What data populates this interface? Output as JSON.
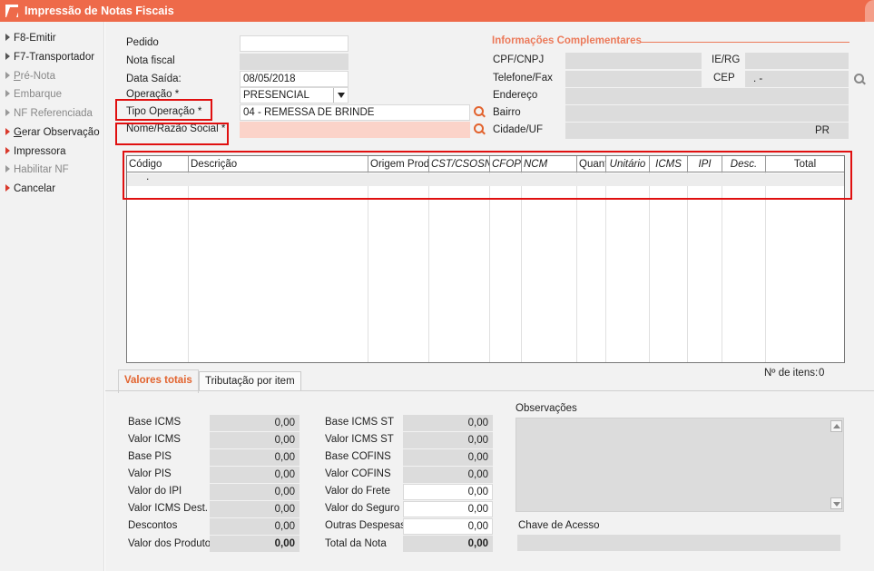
{
  "window": {
    "title": "Impressão de Notas Fiscais"
  },
  "sidebar": {
    "items": [
      {
        "label": "F8-Emitir",
        "state": "normal"
      },
      {
        "label": "F7-Transportador",
        "state": "normal"
      },
      {
        "label": "Pré-Nota",
        "state": "disabled"
      },
      {
        "label": "Embarque",
        "state": "disabled"
      },
      {
        "label": "NF Referenciada",
        "state": "disabled"
      },
      {
        "label": "Gerar Observação",
        "state": "red"
      },
      {
        "label": "Impressora",
        "state": "red"
      },
      {
        "label": "Habilitar NF",
        "state": "disabled"
      },
      {
        "label": "Cancelar",
        "state": "red"
      }
    ]
  },
  "form": {
    "pedido": {
      "label": "Pedido",
      "value": ""
    },
    "nota_fiscal": {
      "label": "Nota fiscal",
      "value": ""
    },
    "data_saida": {
      "label": "Data Saída:",
      "value": "08/05/2018"
    },
    "operacao": {
      "label": "Operação *",
      "value": "PRESENCIAL"
    },
    "tipo_operacao": {
      "label": "Tipo Operação *",
      "value": "04 - REMESSA DE BRINDE"
    },
    "nome_razao": {
      "label": "Nome/Razão Social *",
      "value": ""
    }
  },
  "info_complementares": {
    "title": "Informações Complementares",
    "cpf_cnpj": {
      "label": "CPF/CNPJ",
      "value": ""
    },
    "ie_rg": {
      "label": "IE/RG",
      "value": ""
    },
    "telefone": {
      "label": "Telefone/Fax",
      "value": ""
    },
    "cep": {
      "label": "CEP",
      "value": ". -"
    },
    "endereco": {
      "label": "Endereço",
      "value": ""
    },
    "bairro": {
      "label": "Bairro",
      "value": ""
    },
    "cidade_uf": {
      "label": "Cidade/UF",
      "value": "",
      "uf": "PR"
    }
  },
  "grid": {
    "columns": [
      "Código",
      "Descrição",
      "Origem Prod",
      "CST/CSOSN",
      "CFOP",
      "NCM",
      "Quant",
      "Unitário",
      "ICMS",
      "IPI",
      "Desc.",
      "Total"
    ],
    "rows": [
      {
        "codigo": "."
      }
    ]
  },
  "item_count": {
    "label": "Nº de itens:",
    "value": "0"
  },
  "tabs": [
    {
      "label": "Valores totais"
    },
    {
      "label": "Tributação por item"
    }
  ],
  "totals_left": [
    {
      "label": "Base ICMS",
      "value": "0,00"
    },
    {
      "label": "Valor ICMS",
      "value": "0,00"
    },
    {
      "label": "Base PIS",
      "value": "0,00"
    },
    {
      "label": "Valor PIS",
      "value": "0,00"
    },
    {
      "label": "Valor do IPI",
      "value": "0,00"
    },
    {
      "label": "Valor ICMS Dest.",
      "value": "0,00"
    },
    {
      "label": "Descontos",
      "value": "0,00"
    },
    {
      "label": "Valor dos Produto",
      "value": "0,00"
    }
  ],
  "totals_right": [
    {
      "label": "Base ICMS ST",
      "value": "0,00"
    },
    {
      "label": "Valor ICMS ST",
      "value": "0,00"
    },
    {
      "label": "Base COFINS",
      "value": "0,00"
    },
    {
      "label": "Valor COFINS",
      "value": "0,00"
    },
    {
      "label": "Valor do Frete",
      "value": "0,00"
    },
    {
      "label": "Valor do Seguro",
      "value": "0,00"
    },
    {
      "label": "Outras Despesas",
      "value": "0,00"
    },
    {
      "label": "Total da Nota",
      "value": "0,00"
    }
  ],
  "observacoes": {
    "label": "Observações",
    "value": ""
  },
  "chave_acesso": {
    "label": "Chave de Acesso",
    "value": ""
  },
  "colors": {
    "accent": "#ee6a4a",
    "highlight_box": "#e01010",
    "required_field": "#fbd3c9"
  }
}
